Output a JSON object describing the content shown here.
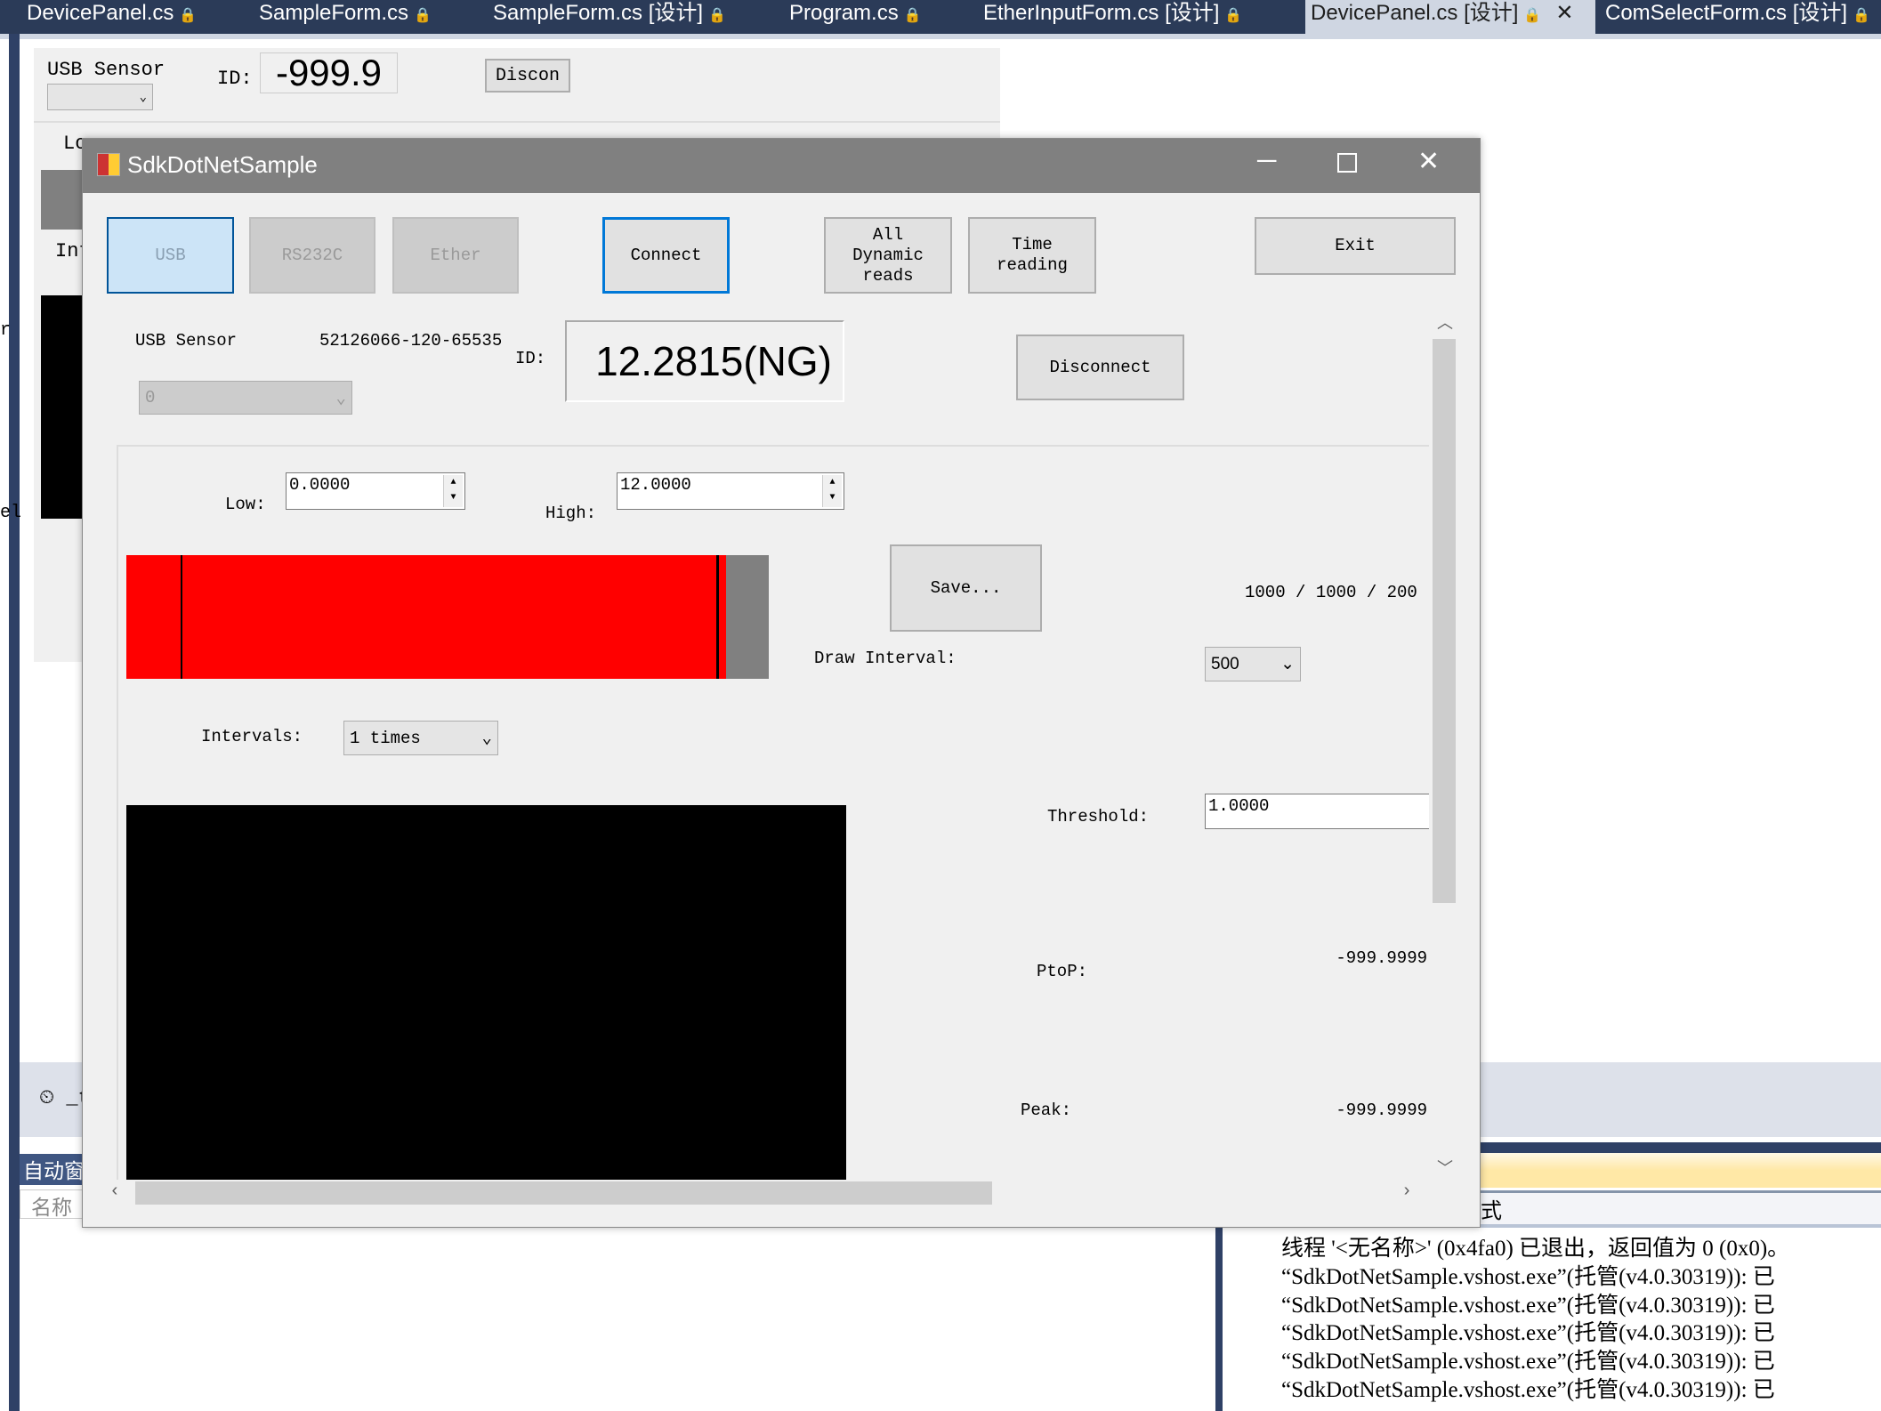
{
  "ide": {
    "tabs": [
      {
        "label": "DevicePanel.cs",
        "active": false
      },
      {
        "label": "SampleForm.cs",
        "active": false
      },
      {
        "label": "SampleForm.cs [设计]",
        "active": false
      },
      {
        "label": "Program.cs",
        "active": false
      },
      {
        "label": "EtherInputForm.cs [设计]",
        "active": false
      },
      {
        "label": "DevicePanel.cs [设计]",
        "active": true
      },
      {
        "label": "ComSelectForm.cs [设计]",
        "active": false
      }
    ],
    "lock_icon": "🔒",
    "close_icon": "✕",
    "left_fragments": [
      "r",
      "el"
    ],
    "timer_component": "_ti",
    "autos_title": "自动窗",
    "autos_column": "名称",
    "output_title_fragment": "式",
    "output_lines": [
      "线程 '<无名称>' (0x4fa0) 已退出，返回值为 0 (0x0)。",
      "“SdkDotNetSample.vshost.exe”(托管(v4.0.30319)): 已",
      "“SdkDotNetSample.vshost.exe”(托管(v4.0.30319)): 已",
      "“SdkDotNetSample.vshost.exe”(托管(v4.0.30319)): 已",
      "“SdkDotNetSample.vshost.exe”(托管(v4.0.30319)): 已",
      "“SdkDotNetSample.vshost.exe”(托管(v4.0.30319)): 已"
    ]
  },
  "designer": {
    "usb_sensor": "USB Sensor",
    "id_label": "ID:",
    "value": "-999.9",
    "disconnect": "Discon",
    "low": "Lo",
    "interval": "Int"
  },
  "dialog": {
    "title": "SdkDotNetSample",
    "buttons": {
      "usb": "USB",
      "rs232c": "RS232C",
      "ether": "Ether",
      "connect": "Connect",
      "all_dynamic": "All Dynamic reads",
      "time_reading": "Time reading",
      "exit": "Exit",
      "disconnect": "Disconnect",
      "save": "Save..."
    },
    "usb_sensor_label": "USB Sensor",
    "serial": "52126066-120-65535",
    "id_label": "ID:",
    "measurement": "12.2815(NG)",
    "sensor_select": "0",
    "low_label": "Low:",
    "low_value": "0.0000",
    "high_label": "High:",
    "high_value": "12.0000",
    "counts": "1000 / 1000 / 200",
    "draw_interval_label": "Draw Interval:",
    "draw_interval_value": "500",
    "intervals_label": "Intervals:",
    "intervals_value": "1 times",
    "threshold_label": "Threshold:",
    "threshold_value": "1.0000",
    "ptop_label": "PtoP:",
    "ptop_value": "-999.9999",
    "peak_label": "Peak:",
    "peak_value": "-999.9999",
    "bar": {
      "fill_color": "#ff0000",
      "fill_fraction": 0.933,
      "marker_color": "#000000"
    }
  }
}
